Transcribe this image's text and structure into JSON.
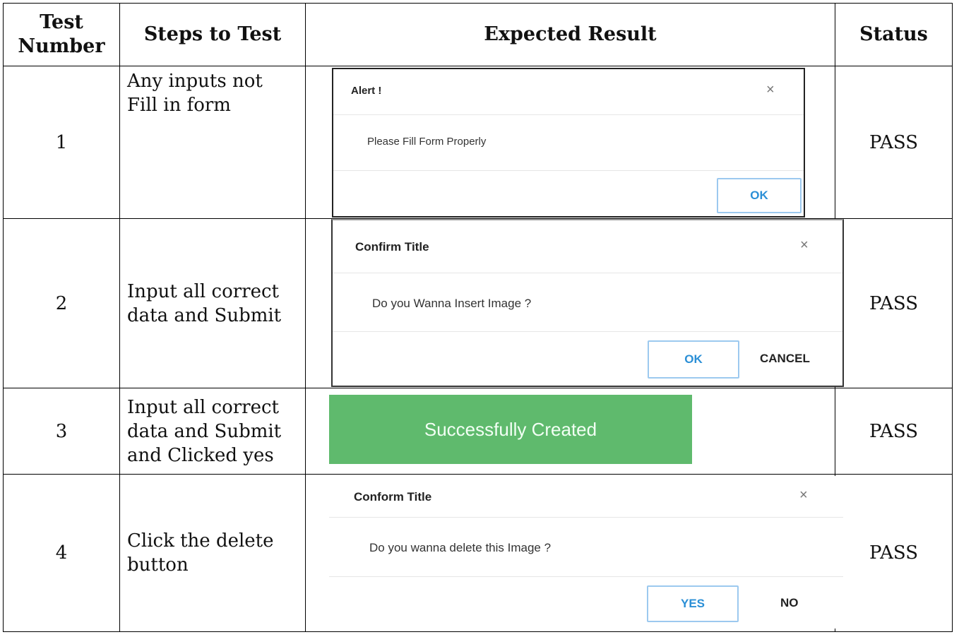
{
  "headers": {
    "test_number": "Test Number",
    "steps": "Steps to Test",
    "expected": "Expected Result",
    "status": "Status"
  },
  "rows": [
    {
      "number": "1",
      "steps": "Any inputs not Fill in form",
      "status": "PASS",
      "dialog": {
        "title": "Alert !",
        "close": "×",
        "message": "Please Fill Form Properly",
        "buttons": [
          "OK"
        ]
      }
    },
    {
      "number": "2",
      "steps": "Input all correct data and Submit",
      "status": "PASS",
      "dialog": {
        "title": "Confirm Title",
        "close": "×",
        "message": "Do you Wanna Insert Image ?",
        "buttons": [
          "OK",
          "CANCEL"
        ]
      }
    },
    {
      "number": "3",
      "steps": "Input all correct data and Submit and Clicked yes",
      "status": "PASS",
      "toast": "Successfully Created"
    },
    {
      "number": "4",
      "steps": "Click the delete button",
      "status": "PASS",
      "dialog": {
        "title": "Conform Title",
        "close": "×",
        "message": "Do you wanna delete this Image ?",
        "buttons": [
          "YES",
          "NO"
        ]
      }
    }
  ],
  "colors": {
    "toast_bg": "#5fba6d",
    "primary_btn": "#2b8fd6"
  }
}
